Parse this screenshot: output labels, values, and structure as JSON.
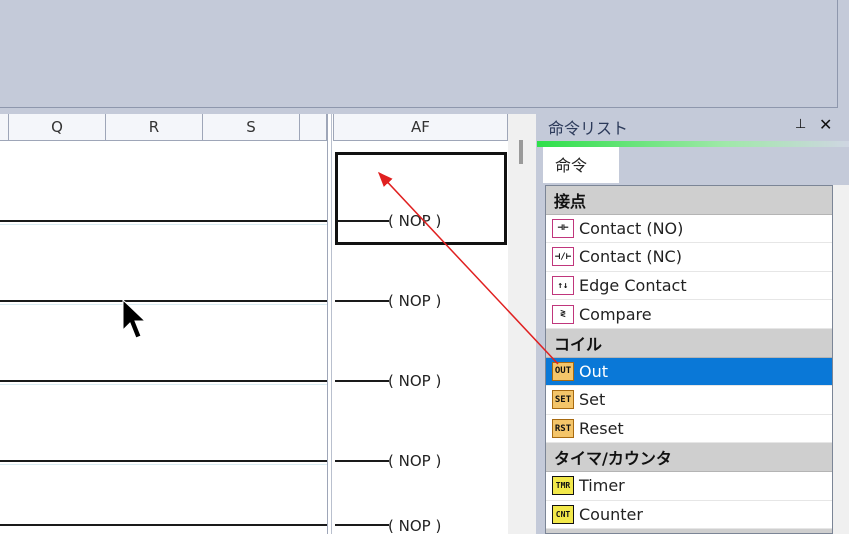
{
  "ladder": {
    "columns": [
      "Q",
      "R",
      "S",
      "AF"
    ],
    "coils": [
      "( NOP )",
      "( NOP )",
      "( NOP )",
      "( NOP )",
      "( NOP )"
    ]
  },
  "panel": {
    "title": "命令リスト",
    "pin_glyph": "⊥",
    "close_glyph": "✕",
    "tab_label": "命令",
    "categories": [
      {
        "label": "接点",
        "items": [
          {
            "label": "Contact (NO)",
            "icon": "contact-no-icon",
            "glyph": "⊣⊢"
          },
          {
            "label": "Contact (NC)",
            "icon": "contact-nc-icon",
            "glyph": "⊣/⊢"
          },
          {
            "label": "Edge Contact",
            "icon": "edge-contact-icon",
            "glyph": "↑↓"
          },
          {
            "label": "Compare",
            "icon": "compare-icon",
            "glyph": "≷"
          }
        ]
      },
      {
        "label": "コイル",
        "items": [
          {
            "label": "Out",
            "icon": "coil-out-icon",
            "glyph": "OUT",
            "selected": true
          },
          {
            "label": "Set",
            "icon": "coil-set-icon",
            "glyph": "SET"
          },
          {
            "label": "Reset",
            "icon": "coil-reset-icon",
            "glyph": "RST"
          }
        ]
      },
      {
        "label": "タイマ/カウンタ",
        "items": [
          {
            "label": "Timer",
            "icon": "timer-icon",
            "glyph": "TMR"
          },
          {
            "label": "Counter",
            "icon": "counter-icon",
            "glyph": "CNT"
          }
        ]
      }
    ]
  },
  "colors": {
    "selection": "#0a78d7",
    "drag_arrow": "#e02020",
    "accent_bar": "#2ee04a"
  }
}
